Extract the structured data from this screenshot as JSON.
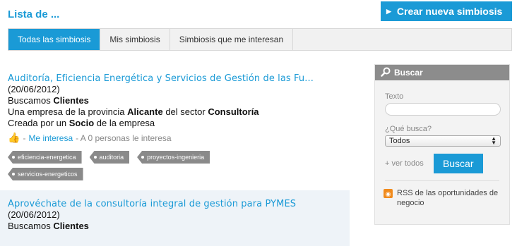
{
  "page": {
    "title": "Lista de ..."
  },
  "toolbar": {
    "create_label": "Crear nueva simbiosis",
    "create_icon": "triangle-right-icon"
  },
  "tabs": [
    {
      "label": "Todas las simbiosis",
      "active": true
    },
    {
      "label": "Mis simbiosis",
      "active": false
    },
    {
      "label": "Simbiosis que me interesan",
      "active": false
    }
  ],
  "items": [
    {
      "title": "Auditoría, Eficiencia Energética y Servicios de Gestión de las Fu...",
      "date": "(20/06/2012)",
      "seek_prefix": "Buscamos",
      "seek_value": "Clientes",
      "company_prefix": "Una empresa de la provincia",
      "province": "Alicante",
      "company_middle": "del sector",
      "sector": "Consultoría",
      "created_prefix": "Creada por un",
      "created_role": "Socio",
      "created_suffix": "de la empresa",
      "interest_dash": "-",
      "interest_link": "Me interesa",
      "interest_count_text": "- A 0 personas le interesa",
      "tags": [
        "eficiencia-energetica",
        "auditoria",
        "proyectos-ingenieria",
        "servicios-energeticos"
      ]
    },
    {
      "title": "Aprovéchate de la consultoría integral de gestión para PYMES",
      "date": "(20/06/2012)",
      "seek_prefix": "Buscamos",
      "seek_value": "Clientes"
    }
  ],
  "sidebar": {
    "header": "Buscar",
    "text_label": "Texto",
    "text_value": "",
    "what_label": "¿Qué busca?",
    "what_value": "Todos",
    "see_all": "+ ver todos",
    "search_button": "Buscar",
    "rss_text": "RSS de las oportunidades de negocio"
  },
  "colors": {
    "accent": "#1a9ad6",
    "tag": "#8a8a8a",
    "sidebar_header": "#8c8c8c"
  }
}
